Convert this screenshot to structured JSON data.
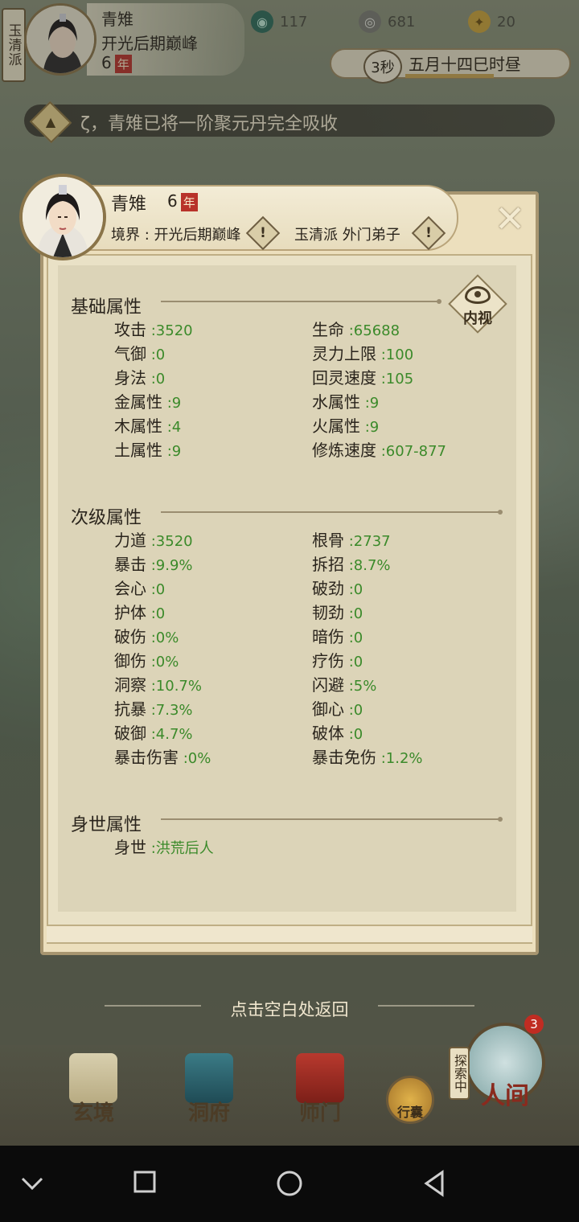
{
  "top": {
    "sect_tag": "玉清派",
    "player_name": "青雉",
    "player_realm": "开光后期巅峰",
    "player_age": "6",
    "age_unit": "年",
    "resources": [
      {
        "icon": "jade-swirl-icon",
        "value": "117"
      },
      {
        "icon": "coin-icon",
        "value": "681"
      },
      {
        "icon": "strength-icon",
        "value": "20"
      }
    ],
    "timer": "3秒",
    "time_text": "五月十四巳时昼",
    "time_progress": 0.55
  },
  "notice": {
    "icon": "bell-icon",
    "text": "ζ，青雉已将一阶聚元丹完全吸收"
  },
  "panel": {
    "name": "青雉",
    "age": "6",
    "age_unit": "年",
    "realm_text": "境界 : 开光后期巅峰",
    "sect_text": "玉清派 外门弟子",
    "close_icon": "close-icon",
    "neishi_label": "内视",
    "sections": {
      "basic": {
        "title": "基础属性",
        "left": [
          {
            "label": "攻击",
            "value": "3520"
          },
          {
            "label": "气御",
            "value": "0"
          },
          {
            "label": "身法",
            "value": "0"
          },
          {
            "label": "金属性",
            "value": "9"
          },
          {
            "label": "木属性",
            "value": "4"
          },
          {
            "label": "土属性",
            "value": "9"
          }
        ],
        "right": [
          {
            "label": "生命",
            "value": "65688"
          },
          {
            "label": "灵力上限",
            "value": "100"
          },
          {
            "label": "回灵速度",
            "value": "105"
          },
          {
            "label": "水属性",
            "value": "9"
          },
          {
            "label": "火属性",
            "value": "9"
          },
          {
            "label": "修炼速度",
            "value": "607-877"
          }
        ]
      },
      "secondary": {
        "title": "次级属性",
        "left": [
          {
            "label": "力道",
            "value": "3520"
          },
          {
            "label": "暴击",
            "value": "9.9%"
          },
          {
            "label": "会心",
            "value": "0"
          },
          {
            "label": "护体",
            "value": "0"
          },
          {
            "label": "破伤",
            "value": "0%"
          },
          {
            "label": "御伤",
            "value": "0%"
          },
          {
            "label": "洞察",
            "value": "10.7%"
          },
          {
            "label": "抗暴",
            "value": "7.3%"
          },
          {
            "label": "破御",
            "value": "4.7%"
          },
          {
            "label": "暴击伤害",
            "value": "0%"
          }
        ],
        "right": [
          {
            "label": "根骨",
            "value": "2737"
          },
          {
            "label": "拆招",
            "value": "8.7%"
          },
          {
            "label": "破劲",
            "value": "0"
          },
          {
            "label": "韧劲",
            "value": "0"
          },
          {
            "label": "暗伤",
            "value": "0"
          },
          {
            "label": "疗伤",
            "value": "0"
          },
          {
            "label": "闪避",
            "value": "5%"
          },
          {
            "label": "御心",
            "value": "0"
          },
          {
            "label": "破体",
            "value": "0"
          },
          {
            "label": "暴击免伤",
            "value": "1.2%"
          }
        ]
      },
      "origin": {
        "title": "身世属性",
        "items": [
          {
            "label": "身世",
            "value": "洪荒后人"
          }
        ]
      }
    }
  },
  "hint": "点击空白处返回",
  "nav": {
    "items": [
      {
        "label": "玄境",
        "icon": "scroll-icon"
      },
      {
        "label": "洞府",
        "icon": "pavilion-icon"
      },
      {
        "label": "师门",
        "icon": "banner-icon"
      },
      {
        "label": "行囊",
        "icon": "bag-icon"
      },
      {
        "label": "人间",
        "icon": "landscape-icon"
      }
    ],
    "explore_label": "探索中",
    "badge": "3"
  },
  "system": {
    "icons": [
      "chevron-down-icon",
      "square-icon",
      "circle-icon",
      "back-triangle-icon"
    ]
  }
}
